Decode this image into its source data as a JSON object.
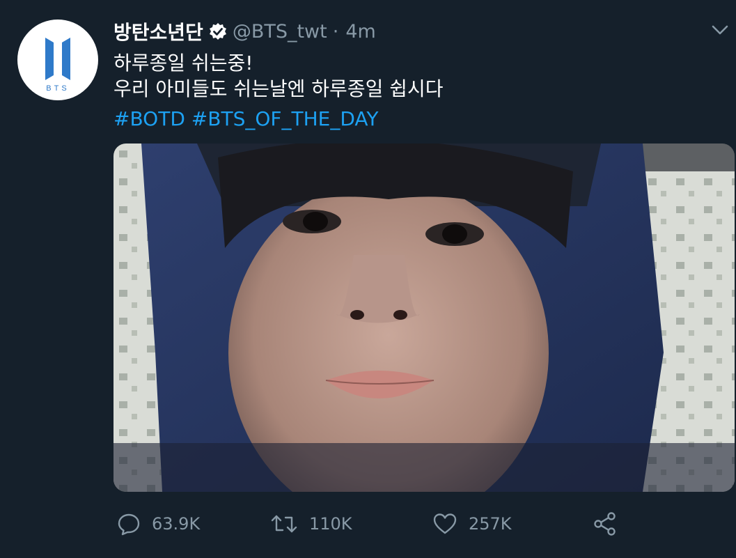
{
  "tweet": {
    "display_name": "방탄소년단",
    "verified_icon": "verified-badge-icon",
    "handle": "@BTS_twt",
    "separator": "·",
    "time": "4m",
    "avatar_text": "BTS",
    "text_lines": [
      "하루종일 쉬는중!",
      "우리 아미들도 쉬는날엔 하루종일 쉽시다"
    ],
    "hashtags": [
      "#BOTD",
      "#BTS_OF_THE_DAY"
    ],
    "media_icon": "selfie-photo",
    "more_icon": "chevron-down-icon"
  },
  "actions": {
    "reply": {
      "icon": "reply-icon",
      "count": "63.9K"
    },
    "retweet": {
      "icon": "retweet-icon",
      "count": "110K"
    },
    "like": {
      "icon": "heart-icon",
      "count": "257K"
    },
    "share": {
      "icon": "share-icon"
    }
  },
  "colors": {
    "background": "#15202b",
    "text": "#ffffff",
    "secondary": "#8899a6",
    "link": "#1da1f2",
    "logo_blue": "#2f7ac9"
  }
}
